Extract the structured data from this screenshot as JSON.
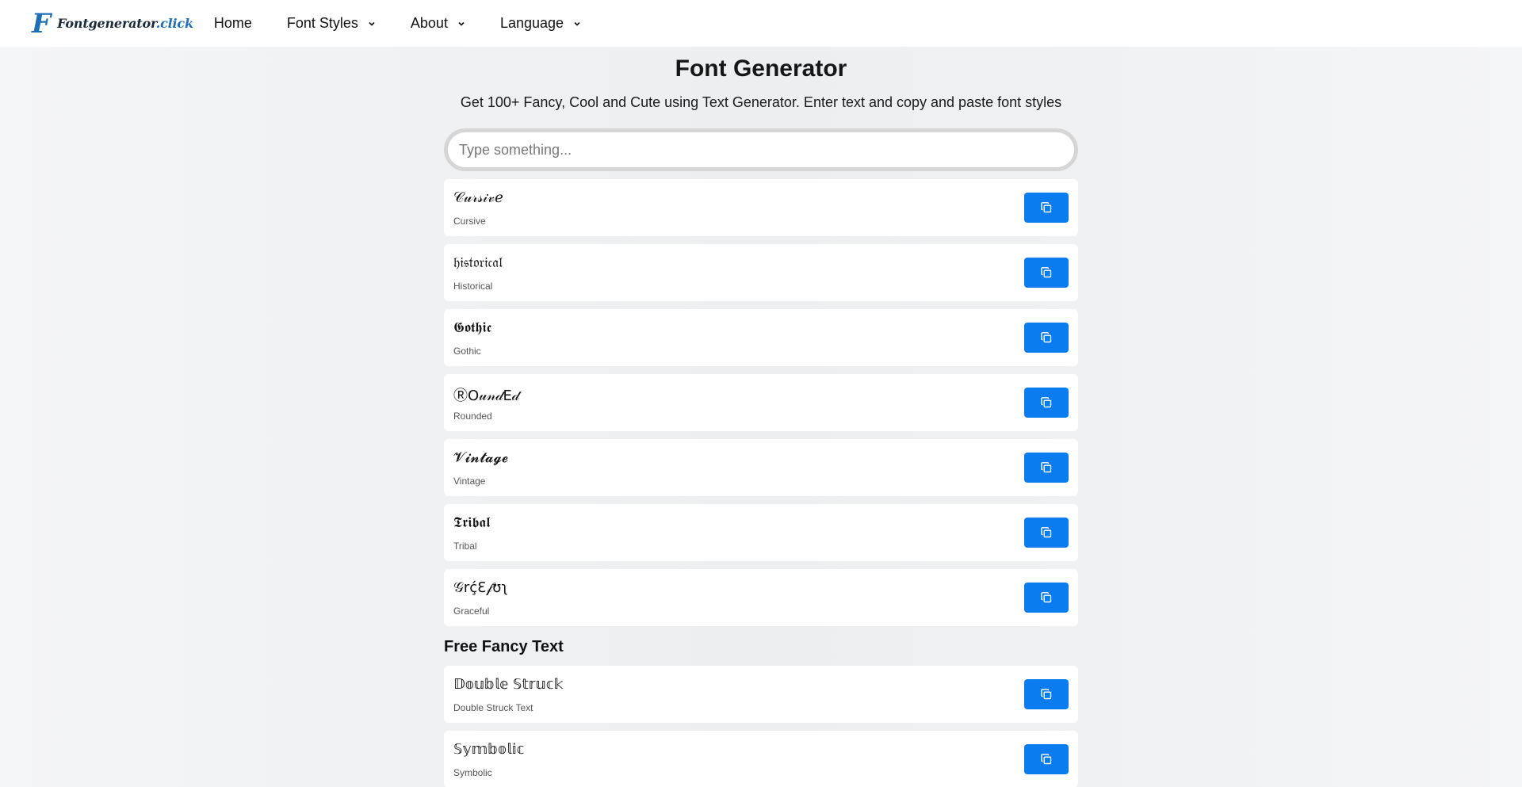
{
  "nav": {
    "logo_mark": "F",
    "logo_name": "Fontgenerator",
    "logo_tld": ".click",
    "items": [
      {
        "label": "Home",
        "has_dropdown": false
      },
      {
        "label": "Font Styles",
        "has_dropdown": true
      },
      {
        "label": "About",
        "has_dropdown": true
      },
      {
        "label": "Language",
        "has_dropdown": true
      }
    ]
  },
  "main": {
    "title": "Font Generator",
    "subtitle": "Get 100+ Fancy, Cool and Cute using Text Generator. Enter text and copy and paste font styles",
    "search": {
      "placeholder": "Type something...",
      "value": ""
    },
    "styles": [
      {
        "preview": "𝒞𝓊𝓇𝓈𝒾𝓋ℯ",
        "name": "Cursive"
      },
      {
        "preview": "𝔥𝔦𝔰𝔱𝔬𝔯𝔦𝔠𝔞𝔩",
        "name": "Historical"
      },
      {
        "preview": "𝕲𝖔𝖙𝖍𝖎𝖈",
        "name": "Gothic"
      },
      {
        "preview": "ⓇO𝓊𝓃𝒹E𝒹",
        "name": "Rounded"
      },
      {
        "preview": "𝓥𝓲𝓷𝓽𝓪𝓰𝓮",
        "name": "Vintage"
      },
      {
        "preview": "𝕿𝖗𝖎𝖇𝖆𝖑",
        "name": "Tribal"
      },
      {
        "preview": "𝒢rḉƐ𝒻ʊʅ",
        "name": "Graceful"
      }
    ],
    "free_heading": "Free Fancy Text",
    "free_styles": [
      {
        "preview": "𝔻𝕠𝕦𝕓𝕝𝕖 𝕊𝕥𝕣𝕦𝕔𝕜",
        "name": "Double Struck Text"
      },
      {
        "preview": "𝕊𝕪𝕞𝕓𝕠𝕝𝕚𝕔",
        "name": "Symbolic"
      }
    ]
  },
  "icons": {
    "copy": "copy-icon",
    "chevron": "chevron-down-icon",
    "accent": "#0b7bf0",
    "logo_color": "#1e6fb8"
  }
}
